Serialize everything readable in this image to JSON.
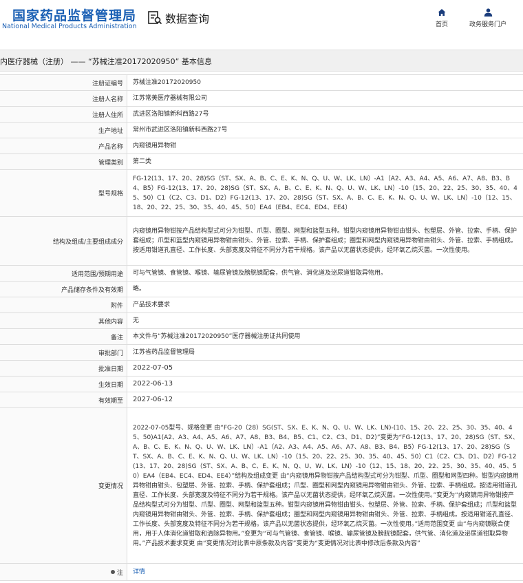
{
  "header": {
    "logo_cn": "国家药品监督管理局",
    "logo_en": "National Medical Products Administration",
    "query_label": "数据查询",
    "nav": [
      {
        "label": "首页",
        "icon": "home-icon"
      },
      {
        "label": "政务服务门户",
        "icon": "user-icon"
      }
    ]
  },
  "title_bar": "内医疗器械（注册） —— “苏械注准20172020950” 基本信息",
  "colors": {
    "brand": "#1a5fb4",
    "title_bg": "#f0f0f0",
    "label_bg": "#fafafa",
    "border": "#dddddd"
  },
  "fields": [
    {
      "label": "注册证编号",
      "value": "苏械注准20172020950"
    },
    {
      "label": "注册人名称",
      "value": "江苏常美医疗器械有限公司"
    },
    {
      "label": "注册人住所",
      "value": "武进区洛阳镇新科西路27号"
    },
    {
      "label": "生产地址",
      "value": "常州市武进区洛阳镇新科西路27号"
    },
    {
      "label": "产品名称",
      "value": "内窥镜用异物钳"
    },
    {
      "label": "管理类别",
      "value": "第二类"
    },
    {
      "label": "型号规格",
      "value": "FG-12(13、17、20、28)SG（ST、SX、A、B、C、E、K、N、Q、U、W、LK、LN）-A1（A2、A3、A4、A5、A6、A7、A8、B3、B4、B5）FG-12(13、17、20、28)SG（ST、SX、A、B、C、E、K、N、Q、U、W、LK、LN）-10（15、20、22、25、30、35、40、45、50）C1（C2、C3、D1、D2）FG-12(13、17、20、28)SG（ST、SX、A、B、C、E、K、N、Q、U、W、LK、LN）-10（12、15、18、20、22、25、30、35、40、45、50）EA4（EB4、EC4、ED4、EE4）"
    },
    {
      "label": "结构及组成/主要组成成分",
      "value": "内窥镜用异物钳按产品结构型式可分为钳型、爪型、圈型、网型和篮型五种。钳型内窥镜用异物钳由钳头、包塑层、外管、拉索、手柄、保护套组成；爪型和篮型内窥镜用异物钳由钳头、外管、拉索、手柄、保护套组成；圈型和网型内窥镜用异物钳由钳头、外管、拉索、手柄组成。按适用钳道孔直径、工作长度、头部宽度及特征不同分为若干规格。该产品以无菌状态提供，经环氧乙烷灭菌。一次性使用。"
    },
    {
      "label": "适用范围/预期用途",
      "value": "可与气管镜、食管镜、喉镜、输尿管镜及膀胱镜配套，供气管、消化道及泌尿道钳取异物用。"
    },
    {
      "label": "产品储存条件及有效期",
      "value": "略。"
    },
    {
      "label": "附件",
      "value": "产品技术要求"
    },
    {
      "label": "其他内容",
      "value": "无"
    },
    {
      "label": "备注",
      "value": "本文件与“苏械注准20172020950”医疗器械注册证共同使用"
    },
    {
      "label": "审批部门",
      "value": "江苏省药品监督管理局"
    },
    {
      "label": "批准日期",
      "value": "2022-07-05"
    },
    {
      "label": "生效日期",
      "value": "2022-06-13"
    },
    {
      "label": "有效期至",
      "value": "2027-06-12"
    },
    {
      "label": "变更情况",
      "value": "2022-07-05型号、规格变更 由“FG-20（28）SG(ST、SX、E、K、N、Q、U、W、LK、LN)-(10、15、20、22、25、30、35、40、45、50)A1(A2、A3、A4、A5、A6、A7、A8、B3、B4、B5、C1、C2、C3、D1、D2)”变更为“FG-12(13、17、20、28)SG（ST、SX、A、B、C、E、K、N、Q、U、W、LK、LN）-A1（A2、A3、A4、A5、A6、A7、A8、B3、B4、B5）FG-12(13、17、20、28)SG（ST、SX、A、B、C、E、K、N、Q、U、W、LK、LN）-10（15、20、22、25、30、35、40、45、50）C1（C2、C3、D1、D2）FG-12(13、17、20、28)SG（ST、SX、A、B、C、E、K、N、Q、U、W、LK、LN）-10（12、15、18、20、22、25、30、35、40、45、50）EA4（EB4、EC4、ED4、EE4）”结构及组成变更 由“内窥镜用异物钳按产品结构型式可分为钳型、爪型、圈型和网型四种。钳型内窥镜用异物钳由钳头、包塑层、外管、拉索、手柄、保护套组成；爪型、圈型和网型内窥镜用异物钳由钳头、外管、拉索、手柄组成。按适用钳道孔直径、工作长度、头部宽度及特征不同分为若干规格。该产品以无菌状态提供，经环氧乙烷灭菌。一次性使用。”变更为“内窥镜用异物钳按产品结构型式可分为钳型、爪型、圈型、网型和篮型五种。钳型内窥镜用异物钳由钳头、包塑层、外管、拉索、手柄、保护套组成；爪型和篮型内窥镜用异物钳由钳头、外管、拉索、手柄、保护套组成；圈型和网型内窥镜用异物钳由钳头、外管、拉索、手柄组成。按适用钳道孔直径、工作长度、头部宽度及特征不同分为若干规格。该产品以无菌状态提供，经环氧乙烷灭菌。一次性使用。”适用范围变更 由“与内窥镜联合使用，用于人体消化道钳取和清除异物用。”变更为“可与气管镜、食管镜、喉镜、输尿管镜及膀胱镜配套，供气管、消化道及泌尿道钳取异物用。”产品技术要求变更 由“变更情况对比表中原条款及内容”变更为“变更情况对比表中修改后条款及内容”"
    },
    {
      "label": "注",
      "value": "详情"
    }
  ]
}
